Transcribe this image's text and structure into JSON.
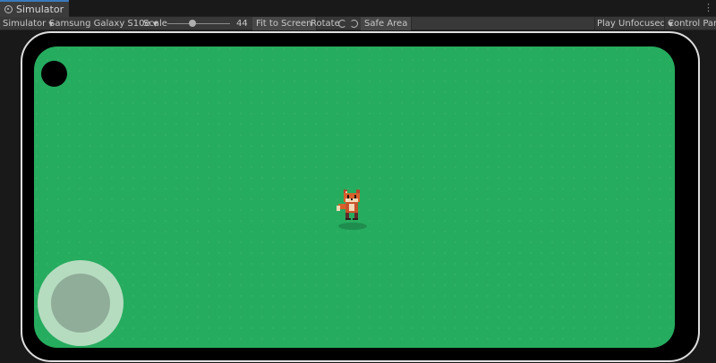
{
  "tab": {
    "title": "Simulator"
  },
  "toolbar": {
    "mode_label": "Simulator",
    "device_label": "Samsung Galaxy S10e",
    "scale_label": "Scale",
    "scale_value": "44",
    "scale_fraction": 0.36,
    "fit_label": "Fit to Screen",
    "rotate_label": "Rotate",
    "safe_area_label": "Safe Area",
    "play_mode_label": "Play Unfocused",
    "control_panel_label": "Control Panel"
  },
  "game": {
    "background_color": "#25ac5e",
    "character": "fox-character",
    "joystick": "virtual-joystick"
  }
}
